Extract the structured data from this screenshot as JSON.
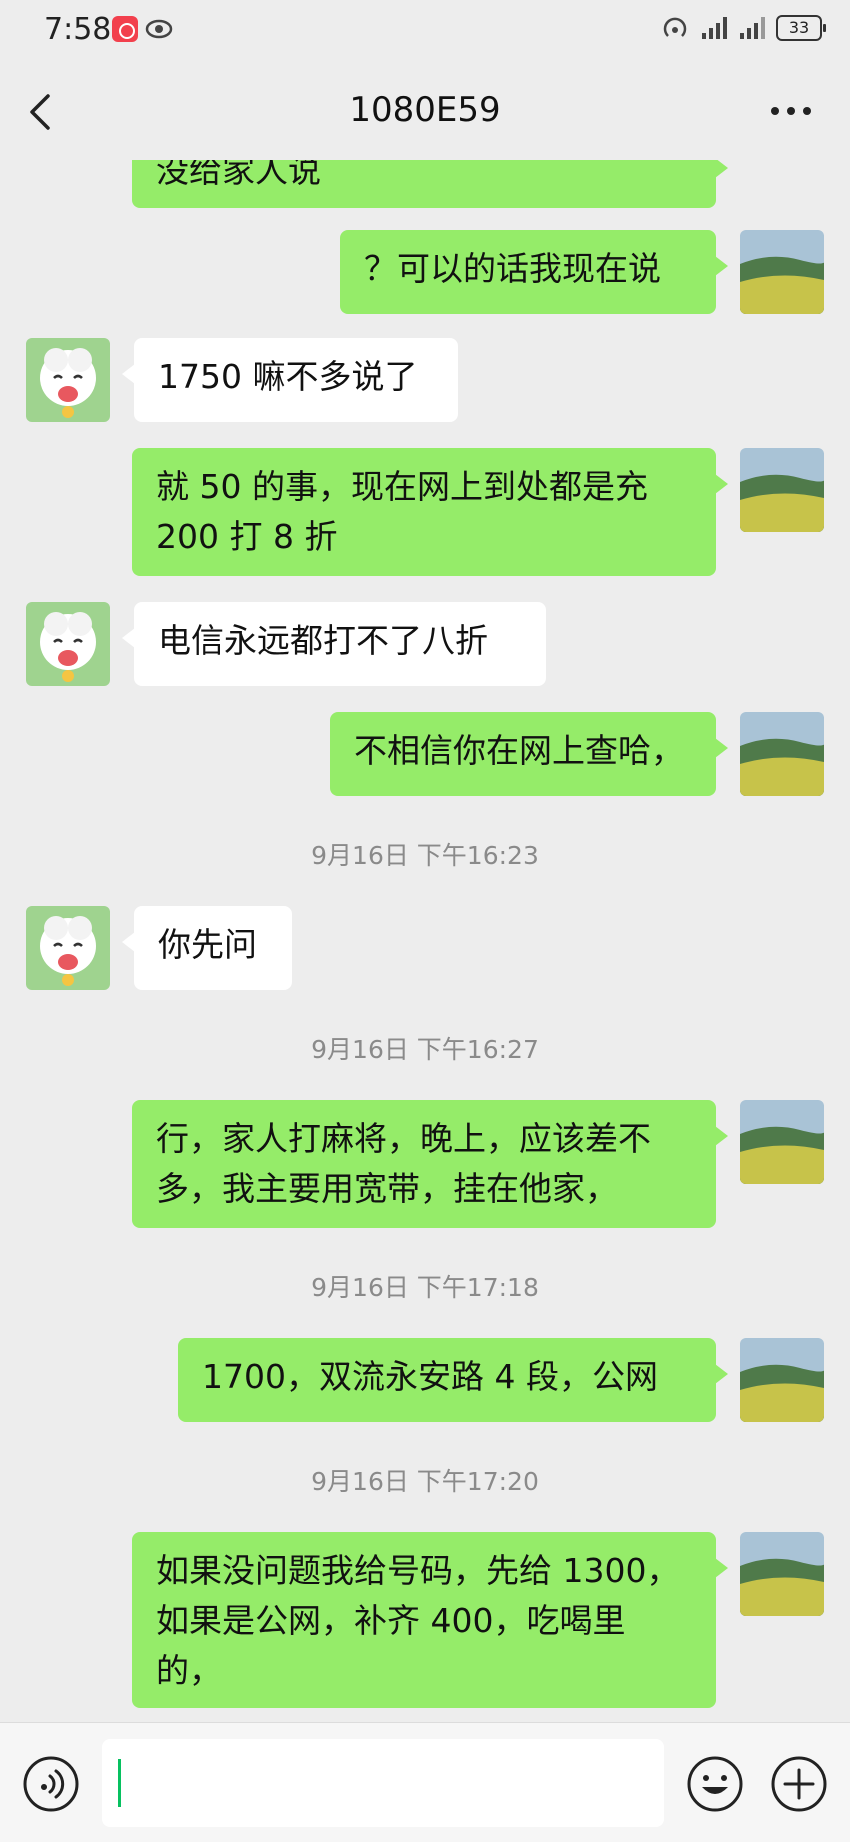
{
  "status_bar": {
    "time": "7:58",
    "battery": "33"
  },
  "header": {
    "title": "1080E59"
  },
  "messages": [
    {
      "id": "m0",
      "side": "out",
      "text": "没给家人说"
    },
    {
      "id": "m1",
      "side": "out",
      "text": "？可以的话我现在说"
    },
    {
      "id": "m2",
      "side": "in",
      "text": "1750 嘛不多说了"
    },
    {
      "id": "m3",
      "side": "out",
      "line1": "就 50 的事，现在网上到处都是充",
      "line2": "200 打 8 折"
    },
    {
      "id": "m4",
      "side": "in",
      "text": "电信永远都打不了八折"
    },
    {
      "id": "m5",
      "side": "out",
      "text": "不相信你在网上查哈，"
    },
    {
      "id": "t1",
      "type": "time",
      "text": "9月16日 下午16:23"
    },
    {
      "id": "m6",
      "side": "in",
      "text": "你先问"
    },
    {
      "id": "t2",
      "type": "time",
      "text": "9月16日 下午16:27"
    },
    {
      "id": "m7",
      "side": "out",
      "line1": "行，家人打麻将，晚上，应该差不",
      "line2": "多，我主要用宽带，挂在他家，"
    },
    {
      "id": "t3",
      "type": "time",
      "text": "9月16日 下午17:18"
    },
    {
      "id": "m8",
      "side": "out",
      "text": "1700，双流永安路 4 段，公网"
    },
    {
      "id": "t4",
      "type": "time",
      "text": "9月16日 下午17:20"
    },
    {
      "id": "m9",
      "side": "out",
      "line1": "如果没问题我给号码，先给 1300，",
      "line2": "如果是公网，补齐 400，吃喝里",
      "line3": "的，"
    }
  ],
  "icons": {
    "back": "back-icon",
    "more": "more-icon",
    "voice": "voice-icon",
    "emoji": "emoji-icon",
    "plus": "plus-icon"
  },
  "colors": {
    "outgoing_bubble": "#95ec69",
    "incoming_bubble": "#ffffff",
    "background": "#ededed",
    "cursor": "#07c160"
  }
}
